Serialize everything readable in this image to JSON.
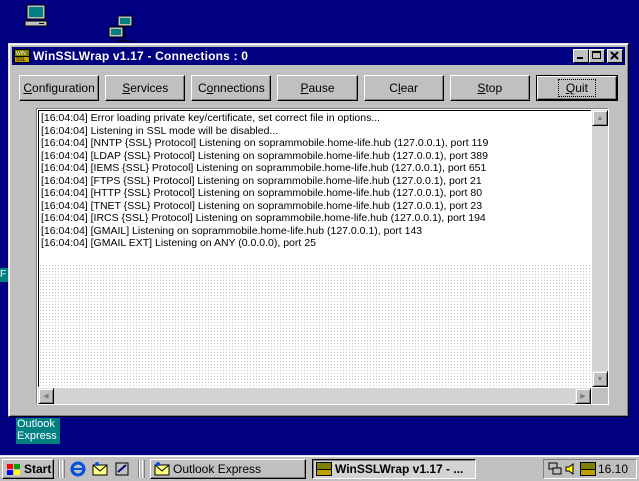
{
  "window": {
    "title": "WinSSLWrap v1.17 - Connections : 0",
    "app_icon": "winsslwrap-icon",
    "caption_buttons": [
      "minimize",
      "maximize",
      "close"
    ]
  },
  "toolbar": {
    "buttons": [
      {
        "label": "Configuration",
        "accel": "C"
      },
      {
        "label": "Services",
        "accel": "S"
      },
      {
        "label": "Connections",
        "accel": "o"
      },
      {
        "label": "Pause",
        "accel": "P"
      },
      {
        "label": "Clear",
        "accel": "l"
      },
      {
        "label": "Stop",
        "accel": "S"
      },
      {
        "label": "Quit",
        "accel": "Q"
      }
    ]
  },
  "log": {
    "lines": [
      "[16:04:04] Error loading private key/certificate, set correct file in options...",
      "[16:04:04] Listening in SSL mode will be disabled...",
      "[16:04:04] [NNTP {SSL} Protocol] Listening on soprammobile.home-life.hub (127.0.0.1), port 119",
      "[16:04:04] [LDAP {SSL} Protocol] Listening on soprammobile.home-life.hub (127.0.0.1), port 389",
      "[16:04:04] [IEMS {SSL} Protocol] Listening on soprammobile.home-life.hub (127.0.0.1), port 651",
      "[16:04:04] [FTPS {SSL} Protocol] Listening on soprammobile.home-life.hub (127.0.0.1), port 21",
      "[16:04:04] [HTTP {SSL} Protocol] Listening on soprammobile.home-life.hub (127.0.0.1), port 80",
      "[16:04:04] [TNET {SSL} Protocol] Listening on soprammobile.home-life.hub (127.0.0.1), port 23",
      "[16:04:04] [IRCS {SSL} Protocol] Listening on soprammobile.home-life.hub (127.0.0.1), port 194",
      "[16:04:04] [GMAIL] Listening on soprammobile.home-life.hub (127.0.0.1), port 143",
      "[16:04:04] [GMAIL EXT] Listening on ANY (0.0.0.0), port 25"
    ]
  },
  "desktop": {
    "outlook_label": "Outlook Express"
  },
  "taskbar": {
    "start_label": "Start",
    "tasks": [
      {
        "label": "Outlook Express",
        "icon": "outlook-express-icon",
        "active": false
      },
      {
        "label": "WinSSLWrap v1.17 - ...",
        "icon": "winsslwrap-icon",
        "active": true
      }
    ],
    "clock": "16.10"
  }
}
